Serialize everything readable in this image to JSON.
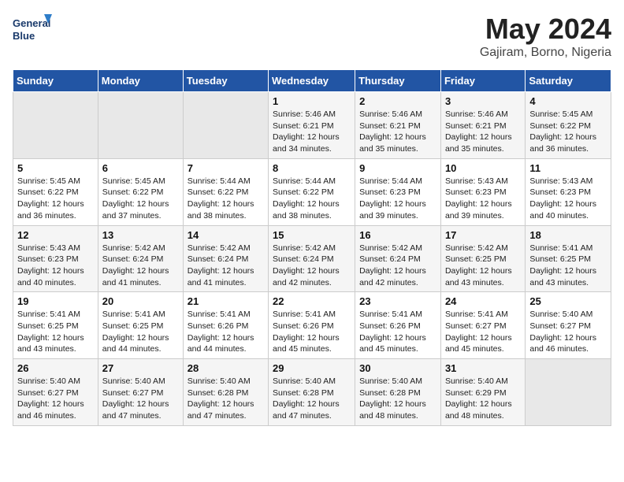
{
  "header": {
    "logo_line1": "General",
    "logo_line2": "Blue",
    "month_year": "May 2024",
    "location": "Gajiram, Borno, Nigeria"
  },
  "weekdays": [
    "Sunday",
    "Monday",
    "Tuesday",
    "Wednesday",
    "Thursday",
    "Friday",
    "Saturday"
  ],
  "weeks": [
    [
      {
        "day": "",
        "empty": true
      },
      {
        "day": "",
        "empty": true
      },
      {
        "day": "",
        "empty": true
      },
      {
        "day": "1",
        "sunrise": "5:46 AM",
        "sunset": "6:21 PM",
        "daylight": "12 hours and 34 minutes."
      },
      {
        "day": "2",
        "sunrise": "5:46 AM",
        "sunset": "6:21 PM",
        "daylight": "12 hours and 35 minutes."
      },
      {
        "day": "3",
        "sunrise": "5:46 AM",
        "sunset": "6:21 PM",
        "daylight": "12 hours and 35 minutes."
      },
      {
        "day": "4",
        "sunrise": "5:45 AM",
        "sunset": "6:22 PM",
        "daylight": "12 hours and 36 minutes."
      }
    ],
    [
      {
        "day": "5",
        "sunrise": "5:45 AM",
        "sunset": "6:22 PM",
        "daylight": "12 hours and 36 minutes."
      },
      {
        "day": "6",
        "sunrise": "5:45 AM",
        "sunset": "6:22 PM",
        "daylight": "12 hours and 37 minutes."
      },
      {
        "day": "7",
        "sunrise": "5:44 AM",
        "sunset": "6:22 PM",
        "daylight": "12 hours and 38 minutes."
      },
      {
        "day": "8",
        "sunrise": "5:44 AM",
        "sunset": "6:22 PM",
        "daylight": "12 hours and 38 minutes."
      },
      {
        "day": "9",
        "sunrise": "5:44 AM",
        "sunset": "6:23 PM",
        "daylight": "12 hours and 39 minutes."
      },
      {
        "day": "10",
        "sunrise": "5:43 AM",
        "sunset": "6:23 PM",
        "daylight": "12 hours and 39 minutes."
      },
      {
        "day": "11",
        "sunrise": "5:43 AM",
        "sunset": "6:23 PM",
        "daylight": "12 hours and 40 minutes."
      }
    ],
    [
      {
        "day": "12",
        "sunrise": "5:43 AM",
        "sunset": "6:23 PM",
        "daylight": "12 hours and 40 minutes."
      },
      {
        "day": "13",
        "sunrise": "5:42 AM",
        "sunset": "6:24 PM",
        "daylight": "12 hours and 41 minutes."
      },
      {
        "day": "14",
        "sunrise": "5:42 AM",
        "sunset": "6:24 PM",
        "daylight": "12 hours and 41 minutes."
      },
      {
        "day": "15",
        "sunrise": "5:42 AM",
        "sunset": "6:24 PM",
        "daylight": "12 hours and 42 minutes."
      },
      {
        "day": "16",
        "sunrise": "5:42 AM",
        "sunset": "6:24 PM",
        "daylight": "12 hours and 42 minutes."
      },
      {
        "day": "17",
        "sunrise": "5:42 AM",
        "sunset": "6:25 PM",
        "daylight": "12 hours and 43 minutes."
      },
      {
        "day": "18",
        "sunrise": "5:41 AM",
        "sunset": "6:25 PM",
        "daylight": "12 hours and 43 minutes."
      }
    ],
    [
      {
        "day": "19",
        "sunrise": "5:41 AM",
        "sunset": "6:25 PM",
        "daylight": "12 hours and 43 minutes."
      },
      {
        "day": "20",
        "sunrise": "5:41 AM",
        "sunset": "6:25 PM",
        "daylight": "12 hours and 44 minutes."
      },
      {
        "day": "21",
        "sunrise": "5:41 AM",
        "sunset": "6:26 PM",
        "daylight": "12 hours and 44 minutes."
      },
      {
        "day": "22",
        "sunrise": "5:41 AM",
        "sunset": "6:26 PM",
        "daylight": "12 hours and 45 minutes."
      },
      {
        "day": "23",
        "sunrise": "5:41 AM",
        "sunset": "6:26 PM",
        "daylight": "12 hours and 45 minutes."
      },
      {
        "day": "24",
        "sunrise": "5:41 AM",
        "sunset": "6:27 PM",
        "daylight": "12 hours and 45 minutes."
      },
      {
        "day": "25",
        "sunrise": "5:40 AM",
        "sunset": "6:27 PM",
        "daylight": "12 hours and 46 minutes."
      }
    ],
    [
      {
        "day": "26",
        "sunrise": "5:40 AM",
        "sunset": "6:27 PM",
        "daylight": "12 hours and 46 minutes."
      },
      {
        "day": "27",
        "sunrise": "5:40 AM",
        "sunset": "6:27 PM",
        "daylight": "12 hours and 47 minutes."
      },
      {
        "day": "28",
        "sunrise": "5:40 AM",
        "sunset": "6:28 PM",
        "daylight": "12 hours and 47 minutes."
      },
      {
        "day": "29",
        "sunrise": "5:40 AM",
        "sunset": "6:28 PM",
        "daylight": "12 hours and 47 minutes."
      },
      {
        "day": "30",
        "sunrise": "5:40 AM",
        "sunset": "6:28 PM",
        "daylight": "12 hours and 48 minutes."
      },
      {
        "day": "31",
        "sunrise": "5:40 AM",
        "sunset": "6:29 PM",
        "daylight": "12 hours and 48 minutes."
      },
      {
        "day": "",
        "empty": true
      }
    ]
  ]
}
